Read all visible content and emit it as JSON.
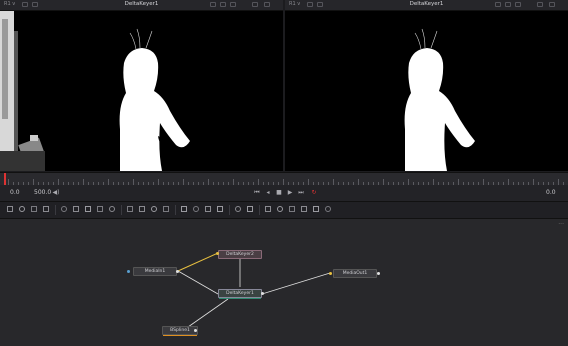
{
  "viewer_left": {
    "label": "R1 v",
    "title": "DeltaKeyer1"
  },
  "viewer_right": {
    "label": "R1 v",
    "title": "DeltaKeyer1"
  },
  "transport": {
    "left_time": "0.0",
    "frame": "500.0",
    "right_time": "0.0"
  },
  "transport_icons": [
    "go-to-start-icon",
    "step-back-icon",
    "stop-icon",
    "play-icon",
    "step-forward-icon",
    "loop-icon"
  ],
  "nodes": {
    "mediain": "MediaIn1",
    "deltakeyer2": "DeltaKeyer2",
    "deltakeyer1": "DeltaKeyer1",
    "mediaout": "MediaOut1",
    "bspline": "BSpline1"
  },
  "colors": {
    "accent_red": "#dd3333",
    "link_yellow": "#e8c040",
    "link_white": "#e0e0e0",
    "bspline_orange": "#e09020"
  }
}
